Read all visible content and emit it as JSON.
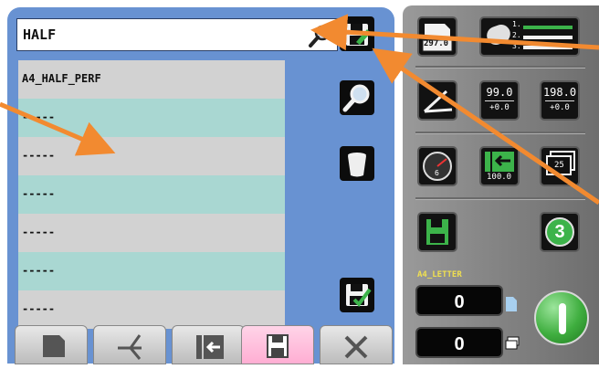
{
  "search": {
    "value": "HALF",
    "icon": "magnifier-icon"
  },
  "list": {
    "rows": [
      "A4_HALF_PERF",
      "-----",
      "-----",
      "-----",
      "-----",
      "-----",
      "-----"
    ]
  },
  "side_buttons": {
    "save_edit": "save-edit-icon",
    "search": "magnifier-icon",
    "delete": "trash-icon",
    "save_new": "save-new-icon"
  },
  "tabs": [
    {
      "name": "paper",
      "active": false
    },
    {
      "name": "fold",
      "active": false
    },
    {
      "name": "feed",
      "active": false
    },
    {
      "name": "memory",
      "active": true
    },
    {
      "name": "tools",
      "active": false
    }
  ],
  "right_panel": {
    "paper_length": "297.0",
    "fold_plates": {
      "labels": [
        "1.",
        "2.",
        "3."
      ]
    },
    "fold1_value": "99.0",
    "fold1_offset": "+0.0",
    "fold2_value": "198.0",
    "fold2_offset": "+0.0",
    "speed_gauge_value": "6",
    "feed_value": "100.0",
    "batch_value": "25",
    "memory_slot_number": "3",
    "job_name": "A4_LETTER",
    "counter_sheets": "0",
    "counter_batches": "0"
  },
  "colors": {
    "panel_blue": "#6892d2",
    "row_gray": "#d2d2d2",
    "row_teal": "#a9d7d2",
    "accent_orange": "#f28a30",
    "start_green": "#4dbb4d",
    "job_name_yellow": "#f0e050"
  }
}
